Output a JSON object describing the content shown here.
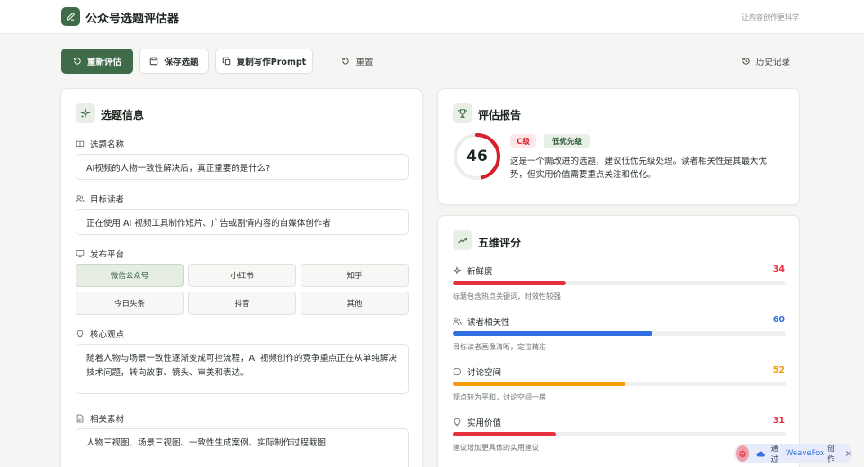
{
  "app": {
    "title": "公众号选题评估器",
    "tagline": "让内容创作更科学"
  },
  "toolbar": {
    "reevaluate": "重新评估",
    "save": "保存选题",
    "copy_prompt": "复制写作Prompt",
    "reset": "重置",
    "history": "历史记录"
  },
  "topic": {
    "title": "选题信息",
    "name_label": "选题名称",
    "name_value": "AI视频的人物一致性解决后，真正重要的是什么?",
    "audience_label": "目标读者",
    "audience_value": "正在使用 AI 视频工具制作短片、广告或剧情内容的自媒体创作者",
    "platform_label": "发布平台",
    "platforms": [
      "微信公众号",
      "小红书",
      "知乎",
      "今日头条",
      "抖音",
      "其他"
    ],
    "selected_platform": "微信公众号",
    "core_label": "核心观点",
    "core_value": "随着人物与场景一致性逐渐变成可控流程，AI 视频创作的竞争重点正在从单纯解决技术问题，转向故事、镜头、审美和表达。",
    "material_label": "相关素材",
    "material_value": "人物三视图、场景三视图、一致性生成案例、实际制作过程截图"
  },
  "report": {
    "title": "评估报告",
    "score": 46,
    "score_max": 100,
    "grade": "C级",
    "priority": "低优先级",
    "summary": "这是一个需改进的选题，建议低优先级处理。读者相关性是其最大优势，但实用价值需要重点关注和优化。"
  },
  "dimensions": {
    "title": "五维评分",
    "max": 100,
    "items": [
      {
        "label": "新鲜度",
        "score": 34,
        "note": "标题包含热点关键词，时效性较强",
        "color": "#e8313f"
      },
      {
        "label": "读者相关性",
        "score": 60,
        "note": "目标读者画像清晰，定位精准",
        "color": "#2f6fe0"
      },
      {
        "label": "讨论空间",
        "score": 52,
        "note": "观点较为平和，讨论空间一般",
        "color": "#f59c0b"
      },
      {
        "label": "实用价值",
        "score": 31,
        "note": "建议增加更具体的实用建议",
        "color": "#e8313f"
      }
    ]
  },
  "colors": {
    "brand": "#3f6b4b",
    "grade": "#d6202c",
    "priority": "#2f5a3a"
  },
  "weavefox": {
    "prefix": "通过",
    "brand": "WeaveFox",
    "suffix": "创作",
    "close": "×"
  }
}
